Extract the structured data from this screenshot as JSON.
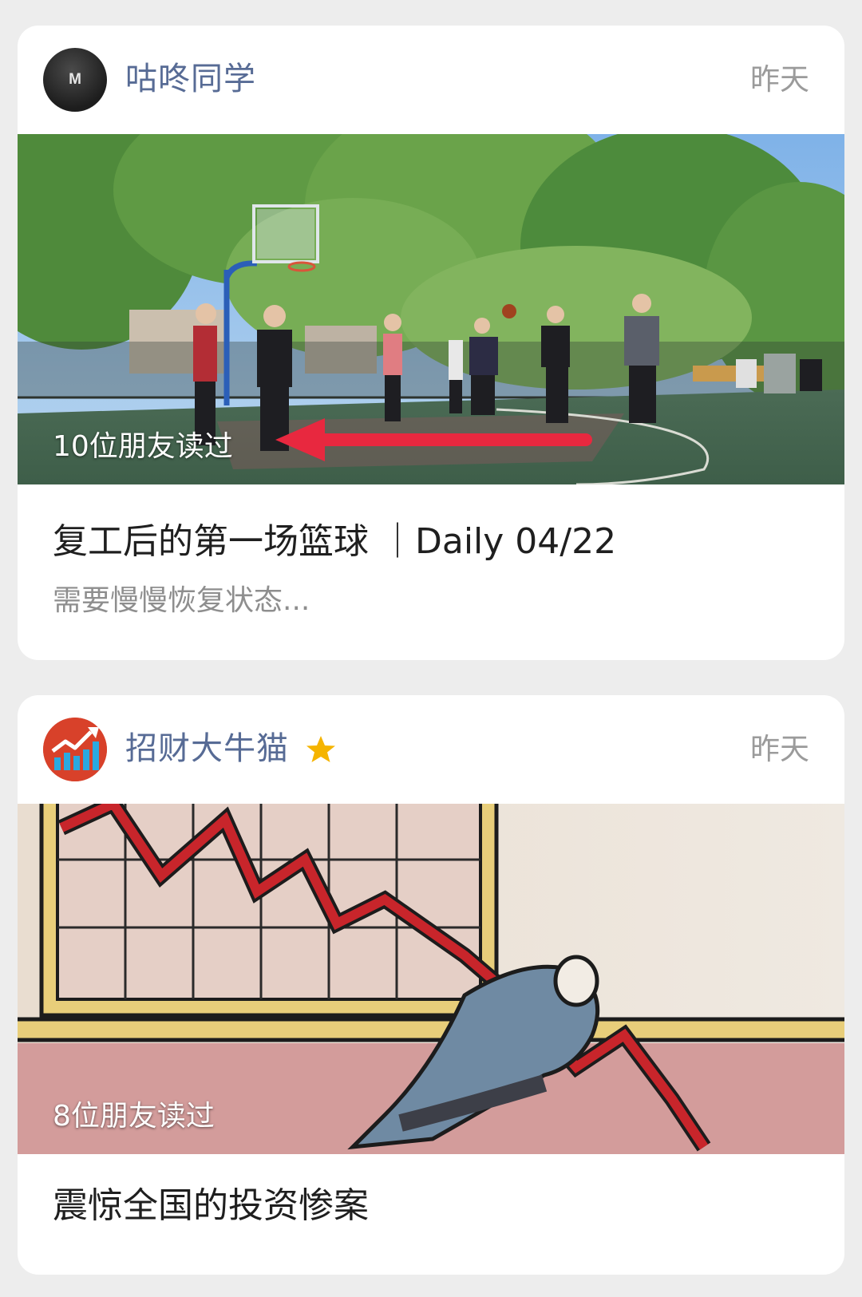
{
  "feed": {
    "articles": [
      {
        "account": {
          "name": "咕咚同学",
          "avatar_letter": "M",
          "starred": false
        },
        "time": "昨天",
        "read_count": "10位朋友读过",
        "title": "复工后的第一场篮球 ｜Daily 04/22",
        "digest": "需要慢慢恢复状态..."
      },
      {
        "account": {
          "name": "招财大牛猫",
          "avatar_icon": "rising-chart-icon",
          "starred": true
        },
        "time": "昨天",
        "read_count": "8位朋友读过",
        "title": "震惊全国的投资惨案"
      }
    ]
  },
  "colors": {
    "page_background": "#ededed",
    "account_name": "#576b95",
    "star": "#f5b400",
    "arrow_annotation": "#e8283f"
  }
}
